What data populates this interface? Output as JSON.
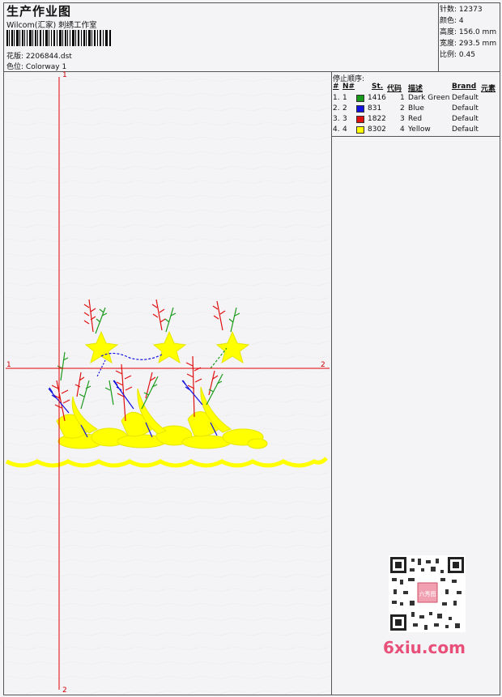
{
  "header": {
    "title": "生产作业图",
    "studio": "Wilcom(汇家) 刺绣工作室",
    "design_label": "花版:",
    "design_value": "2206844.dst",
    "colorway_label": "色位:",
    "colorway_value": "Colorway 1"
  },
  "stats": [
    {
      "label": "针数:",
      "value": "12373"
    },
    {
      "label": "颜色:",
      "value": "4"
    },
    {
      "label": "高度:",
      "value": "156.0 mm"
    },
    {
      "label": "宽度:",
      "value": "293.5 mm"
    },
    {
      "label": "比例:",
      "value": "0.45"
    }
  ],
  "stop_sequence": {
    "heading": "停止顺序:",
    "columns": [
      "#",
      "N#",
      "St.",
      "代码",
      "描述",
      "Brand",
      "元素"
    ],
    "rows": [
      {
        "idx": "1.",
        "n": "1",
        "color": "#1a9a1a",
        "st": "1416",
        "code": "1",
        "desc": "Dark Green",
        "brand": "Default"
      },
      {
        "idx": "2.",
        "n": "2",
        "color": "#1010e0",
        "st": "831",
        "code": "2",
        "desc": "Blue",
        "brand": "Default"
      },
      {
        "idx": "3.",
        "n": "3",
        "color": "#e01010",
        "st": "1822",
        "code": "3",
        "desc": "Red",
        "brand": "Default"
      },
      {
        "idx": "4.",
        "n": "4",
        "color": "#ffff00",
        "st": "8302",
        "code": "4",
        "desc": "Yellow",
        "brand": "Default"
      }
    ]
  },
  "axes": {
    "v_top": "1",
    "v_bottom": "2",
    "h_left": "1",
    "h_right": "2"
  },
  "watermark": {
    "text": "6xiu.com",
    "seal": "六秀图"
  },
  "colors": {
    "yellow": "#ffff00",
    "red": "#e01010",
    "blue": "#1010e0",
    "green": "#1a9a1a",
    "axis": "#e00000"
  }
}
